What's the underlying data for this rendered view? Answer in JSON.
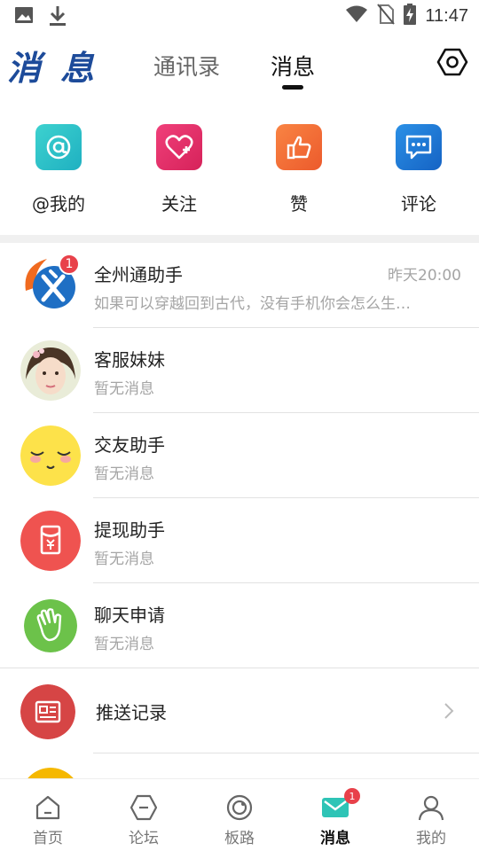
{
  "status_bar": {
    "time": "11:47"
  },
  "header": {
    "logo": "消息",
    "tabs": [
      {
        "label": "通讯录",
        "active": false
      },
      {
        "label": "消息",
        "active": true
      }
    ]
  },
  "quick_actions": [
    {
      "label": "@我的",
      "icon": "at-icon",
      "color": "#27c3c6"
    },
    {
      "label": "关注",
      "icon": "heart-plus-icon",
      "color": "#e8336a"
    },
    {
      "label": "赞",
      "icon": "thumbs-up-icon",
      "color": "#f2703a"
    },
    {
      "label": "评论",
      "icon": "comment-icon",
      "color": "#1a7bd6"
    }
  ],
  "messages": [
    {
      "name": "全州通助手",
      "preview": "如果可以穿越回到古代，没有手机你会怎么生…",
      "time": "昨天20:00",
      "badge": "1"
    },
    {
      "name": "客服妹妹",
      "preview": "暂无消息"
    },
    {
      "name": "交友助手",
      "preview": "暂无消息"
    },
    {
      "name": "提现助手",
      "preview": "暂无消息"
    },
    {
      "name": "聊天申请",
      "preview": "暂无消息"
    },
    {
      "name": "推送记录"
    }
  ],
  "bottom_nav": [
    {
      "label": "首页",
      "active": false
    },
    {
      "label": "论坛",
      "active": false
    },
    {
      "label": "板路",
      "active": false
    },
    {
      "label": "消息",
      "active": true,
      "badge": "1"
    },
    {
      "label": "我的",
      "active": false
    }
  ]
}
